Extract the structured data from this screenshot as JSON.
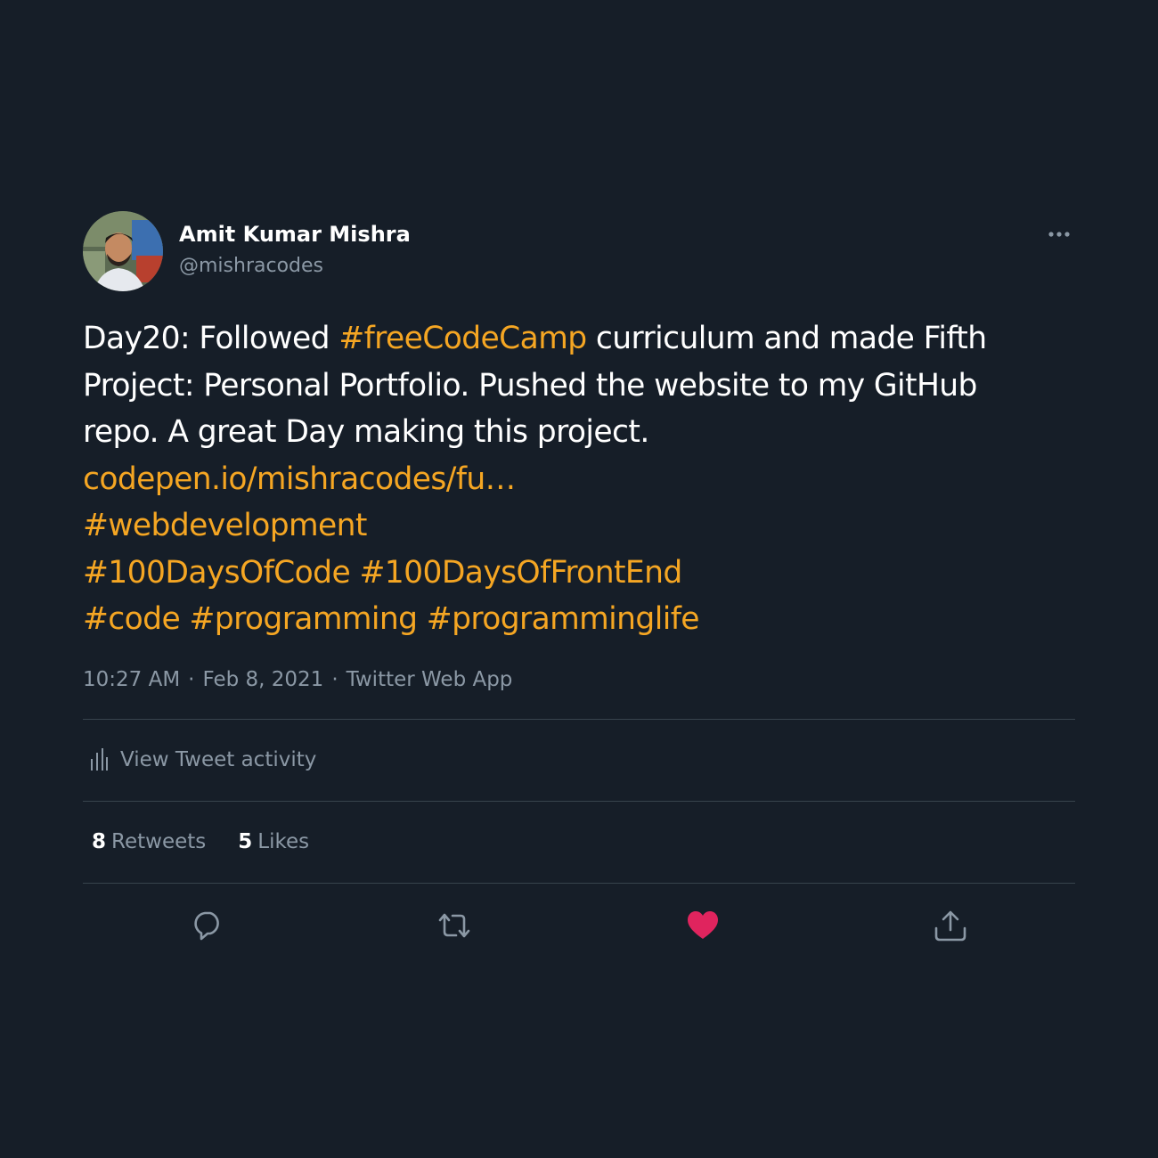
{
  "user": {
    "display_name": "Amit Kumar Mishra",
    "handle": "@mishracodes",
    "avatar_icon": "profile-photo"
  },
  "tweet": {
    "lines": [
      [
        {
          "text": "Day20: Followed ",
          "highlight": false
        },
        {
          "text": "#freeCodeCamp",
          "highlight": true
        },
        {
          "text": " curriculum and made Fifth",
          "highlight": false
        }
      ],
      [
        {
          "text": "Project: Personal Portfolio. Pushed the website to my GitHub",
          "highlight": false
        }
      ],
      [
        {
          "text": "repo. A great Day making this project.",
          "highlight": false
        }
      ],
      [
        {
          "text": "codepen.io/mishracodes/fu…",
          "highlight": true
        }
      ],
      [
        {
          "text": "#webdevelopment",
          "highlight": true
        }
      ],
      [
        {
          "text": "#100DaysOfCode",
          "highlight": true
        },
        {
          "text": " ",
          "highlight": false
        },
        {
          "text": "#100DaysOfFrontEnd",
          "highlight": true
        }
      ],
      [
        {
          "text": "#code",
          "highlight": true
        },
        {
          "text": " ",
          "highlight": false
        },
        {
          "text": "#programming",
          "highlight": true
        },
        {
          "text": " ",
          "highlight": false
        },
        {
          "text": "#programminglife",
          "highlight": true
        }
      ]
    ],
    "time": "10:27 AM",
    "separator": "·",
    "date": "Feb 8, 2021",
    "source": "Twitter Web App"
  },
  "activity": {
    "label": "View Tweet activity",
    "icon": "analytics-bars-icon"
  },
  "stats": {
    "retweets_count": "8",
    "retweets_label": "Retweets",
    "likes_count": "5",
    "likes_label": "Likes"
  },
  "actions": {
    "reply_icon": "reply-icon",
    "retweet_icon": "retweet-icon",
    "like_icon": "heart-icon",
    "share_icon": "share-icon",
    "liked": true
  },
  "colors": {
    "background": "#161e28",
    "accent": "#f5a623",
    "muted": "#8b98a5",
    "like": "#e0245e"
  }
}
